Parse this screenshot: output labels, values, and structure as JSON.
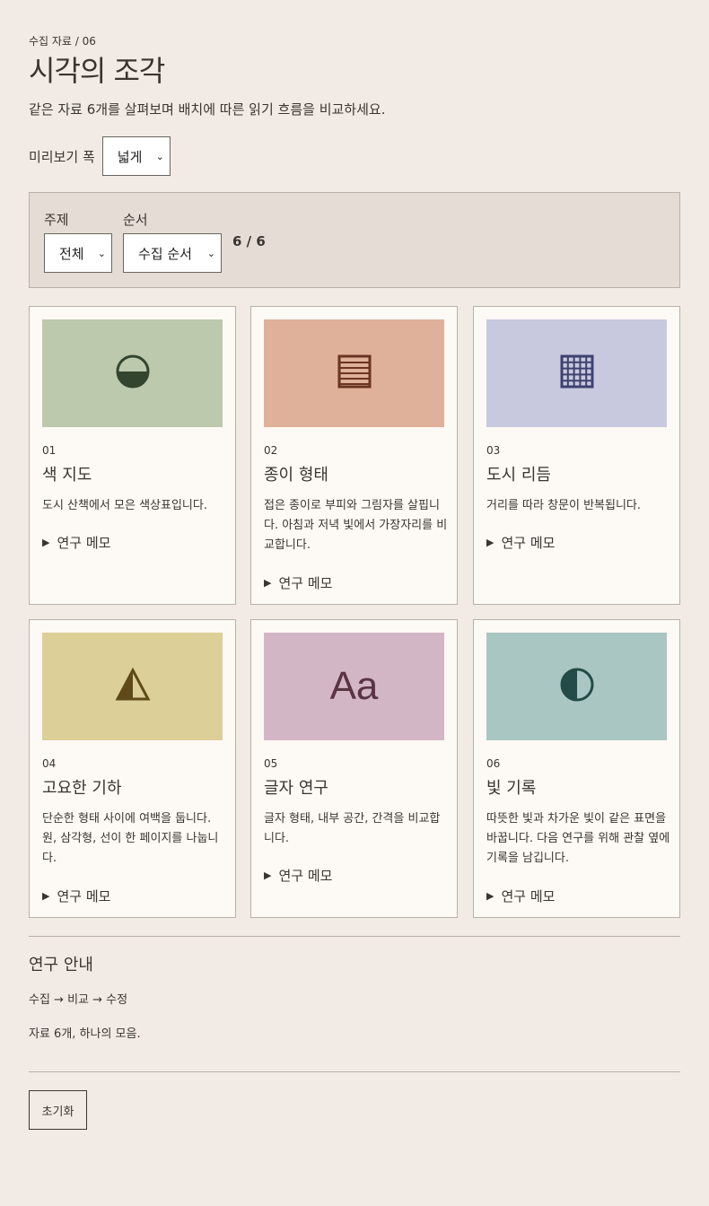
{
  "header": {
    "breadcrumb": "수집 자료 / 06",
    "title": "시각의 조각",
    "intro": "같은 자료 6개를 살펴보며 배치에 따른 읽기 흐름을 비교하세요."
  },
  "preview": {
    "label": "미리보기 폭",
    "value": "넓게"
  },
  "filters": {
    "topic_label": "주제",
    "topic_value": "전체",
    "order_label": "순서",
    "order_value": "수집 순서",
    "count": "6 / 6"
  },
  "cards": [
    {
      "num": "01",
      "title": "색 지도",
      "desc": "도시 산책에서 모은 색상표입니다.",
      "memo": "연구 메모",
      "icon": "half-circle-icon",
      "bg": "#bcc9ad",
      "fg": "#33452f"
    },
    {
      "num": "02",
      "title": "종이 형태",
      "desc": "접은 종이로 부피와 그림자를 살핍니다. 아침과 저녁 빛에서 가장자리를 비교합니다.",
      "memo": "연구 메모",
      "icon": "striped-square-icon",
      "bg": "#dfb19a",
      "fg": "#6a3322"
    },
    {
      "num": "03",
      "title": "도시 리듬",
      "desc": "거리를 따라 창문이 반복됩니다.",
      "memo": "연구 메모",
      "icon": "grid-icon",
      "bg": "#c8c9de",
      "fg": "#3e4170"
    },
    {
      "num": "04",
      "title": "고요한 기하",
      "desc": "단순한 형태 사이에 여백을 둡니다. 원, 삼각형, 선이 한 페이지를 나눕니다.",
      "memo": "연구 메모",
      "icon": "triangle-icon",
      "bg": "#ddcf98",
      "fg": "#5e4a18"
    },
    {
      "num": "05",
      "title": "글자 연구",
      "desc": "글자 형태, 내부 공간, 간격을 비교합니다.",
      "memo": "연구 메모",
      "icon": "Aa",
      "bg": "#d3b6c5",
      "fg": "#5a3445"
    },
    {
      "num": "06",
      "title": "빛 기록",
      "desc": "따뜻한 빛과 차가운 빛이 같은 표면을 바꿉니다. 다음 연구를 위해 관찰 옆에 기록을 남깁니다.",
      "memo": "연구 메모",
      "icon": "half-moon-icon",
      "bg": "#a9c6c2",
      "fg": "#234b47"
    }
  ],
  "guide": {
    "title": "연구 안내",
    "flow": "수집 → 비교 → 수정",
    "note": "자료 6개, 하나의 모음."
  },
  "reset_label": "초기화"
}
